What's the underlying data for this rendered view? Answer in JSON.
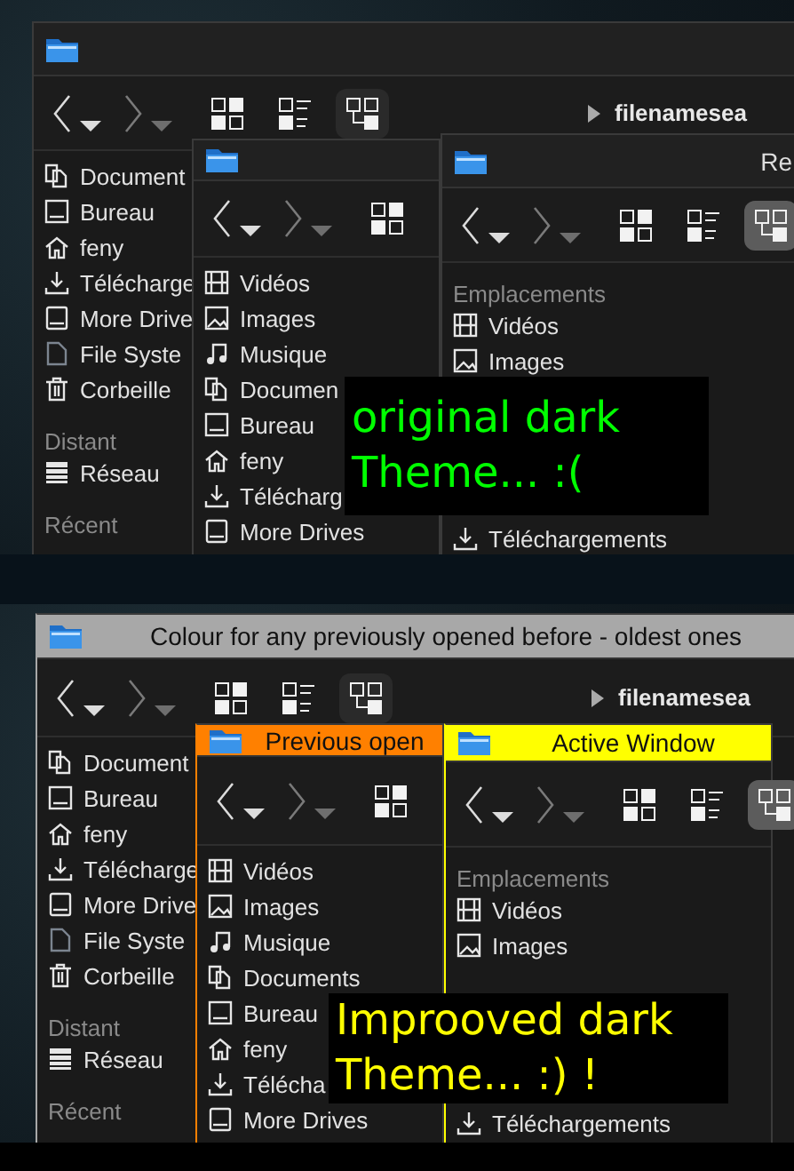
{
  "panels": [
    {
      "windows": [
        {
          "toolbar": [
            {
              "kind": "back",
              "disabled": false
            },
            {
              "kind": "menu"
            },
            {
              "kind": "forward",
              "disabled": true
            },
            {
              "kind": "menu"
            },
            {
              "kind": "icons",
              "selected": false
            },
            {
              "kind": "details",
              "selected": false
            },
            {
              "kind": "tree",
              "selected": true
            }
          ],
          "path": "filenamesea",
          "sidebar": [
            {
              "kind": "documents",
              "label": "Document"
            },
            {
              "kind": "desktop",
              "label": "Bureau"
            },
            {
              "kind": "home",
              "label": "feny"
            },
            {
              "kind": "downloads",
              "label": "Télécharge"
            },
            {
              "kind": "drive",
              "label": "More Drive"
            },
            {
              "kind": "file",
              "label": "File Syste"
            },
            {
              "kind": "trash",
              "label": "Corbeille"
            },
            {
              "kind": "header",
              "label": "Distant"
            },
            {
              "kind": "network",
              "label": "Réseau"
            },
            {
              "kind": "header",
              "label": "Récent"
            }
          ]
        },
        {
          "toolbar": [
            {
              "kind": "back",
              "disabled": false
            },
            {
              "kind": "menu"
            },
            {
              "kind": "forward",
              "disabled": true
            },
            {
              "kind": "menu"
            },
            {
              "kind": "icons",
              "selected": false
            }
          ],
          "sidebar": [
            {
              "kind": "videos",
              "label": "Vidéos"
            },
            {
              "kind": "images",
              "label": "Images"
            },
            {
              "kind": "music",
              "label": "Musique"
            },
            {
              "kind": "documents",
              "label": "Documen"
            },
            {
              "kind": "desktop",
              "label": "Bureau"
            },
            {
              "kind": "home",
              "label": "feny"
            },
            {
              "kind": "downloads",
              "label": "Télécharg"
            },
            {
              "kind": "drive",
              "label": "More Drives"
            }
          ]
        },
        {
          "title": "Re",
          "toolbar": [
            {
              "kind": "back",
              "disabled": false
            },
            {
              "kind": "menu"
            },
            {
              "kind": "forward",
              "disabled": true
            },
            {
              "kind": "menu"
            },
            {
              "kind": "icons",
              "selected": false
            },
            {
              "kind": "details",
              "selected": false
            },
            {
              "kind": "tree",
              "selected": true
            }
          ],
          "sidebar": [
            {
              "kind": "header",
              "label": "Emplacements"
            },
            {
              "kind": "videos",
              "label": "Vidéos"
            },
            {
              "kind": "images",
              "label": "Images"
            },
            {
              "kind": "downloads",
              "label": "Téléchargements"
            }
          ]
        }
      ],
      "caption": {
        "lines": [
          "original dark",
          "Theme... :("
        ],
        "color": "#00ff00"
      }
    },
    {
      "windows": [
        {
          "title": "Colour for any previously opened before - oldest ones",
          "color": "#a8a8a8",
          "toolbar": [
            {
              "kind": "back",
              "disabled": false
            },
            {
              "kind": "menu"
            },
            {
              "kind": "forward",
              "disabled": true
            },
            {
              "kind": "menu"
            },
            {
              "kind": "icons",
              "selected": false
            },
            {
              "kind": "details",
              "selected": false
            },
            {
              "kind": "tree",
              "selected": true
            }
          ],
          "path": "filenamesea",
          "sidebar": [
            {
              "kind": "documents",
              "label": "Document"
            },
            {
              "kind": "desktop",
              "label": "Bureau"
            },
            {
              "kind": "home",
              "label": "feny"
            },
            {
              "kind": "downloads",
              "label": "Télécharge"
            },
            {
              "kind": "drive",
              "label": "More Drive"
            },
            {
              "kind": "file",
              "label": "File Syste"
            },
            {
              "kind": "trash",
              "label": "Corbeille"
            },
            {
              "kind": "header",
              "label": "Distant"
            },
            {
              "kind": "network",
              "label": "Réseau"
            },
            {
              "kind": "header",
              "label": "Récent"
            }
          ]
        },
        {
          "title": "Previous open",
          "color": "#ff8000",
          "toolbar": [
            {
              "kind": "back",
              "disabled": false
            },
            {
              "kind": "menu"
            },
            {
              "kind": "forward",
              "disabled": true
            },
            {
              "kind": "menu"
            },
            {
              "kind": "icons",
              "selected": false
            }
          ],
          "sidebar": [
            {
              "kind": "videos",
              "label": "Vidéos"
            },
            {
              "kind": "images",
              "label": "Images"
            },
            {
              "kind": "music",
              "label": "Musique"
            },
            {
              "kind": "documents",
              "label": "Documents"
            },
            {
              "kind": "desktop",
              "label": "Bureau"
            },
            {
              "kind": "home",
              "label": "feny"
            },
            {
              "kind": "downloads",
              "label": "Télécha"
            },
            {
              "kind": "drive",
              "label": "More Drives"
            }
          ]
        },
        {
          "title": "Active Window",
          "color": "#ffff00",
          "toolbar": [
            {
              "kind": "back",
              "disabled": false
            },
            {
              "kind": "menu"
            },
            {
              "kind": "forward",
              "disabled": true
            },
            {
              "kind": "menu"
            },
            {
              "kind": "icons",
              "selected": false
            },
            {
              "kind": "details",
              "selected": false
            },
            {
              "kind": "tree",
              "selected": true
            }
          ],
          "sidebar": [
            {
              "kind": "header",
              "label": "Emplacements"
            },
            {
              "kind": "videos",
              "label": "Vidéos"
            },
            {
              "kind": "images",
              "label": "Images"
            },
            {
              "kind": "downloads",
              "label": "Téléchargements"
            }
          ]
        }
      ],
      "caption": {
        "lines": [
          "Improoved dark",
          "Theme...  :) !"
        ],
        "color": "#ffff00"
      }
    }
  ]
}
